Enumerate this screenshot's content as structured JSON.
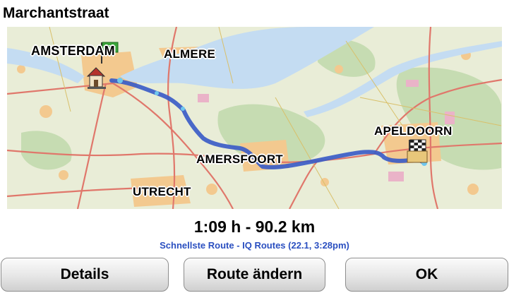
{
  "header": {
    "title": "Marchantstraat"
  },
  "map": {
    "cities": [
      {
        "key": "amsterdam",
        "label": "AMSTERDAM"
      },
      {
        "key": "almere",
        "label": "ALMERE"
      },
      {
        "key": "amersfoort",
        "label": "AMERSFOORT"
      },
      {
        "key": "utrecht",
        "label": "UTRECHT"
      },
      {
        "key": "apeldoorn",
        "label": "APELDOORN"
      }
    ],
    "start_badge": "GO",
    "colors": {
      "route": "#3b5cc7",
      "water": "#c4dcf2",
      "road": "#e0776b",
      "urban": "#f3c98f",
      "park": "#c6dcb2",
      "land": "#e9edd7"
    }
  },
  "route": {
    "summary": "1:09 h - 90.2 km",
    "detail": "Schnellste Route - IQ Routes (22.1,  3:28pm)"
  },
  "buttons": {
    "details": "Details",
    "change": "Route ändern",
    "ok": "OK"
  }
}
